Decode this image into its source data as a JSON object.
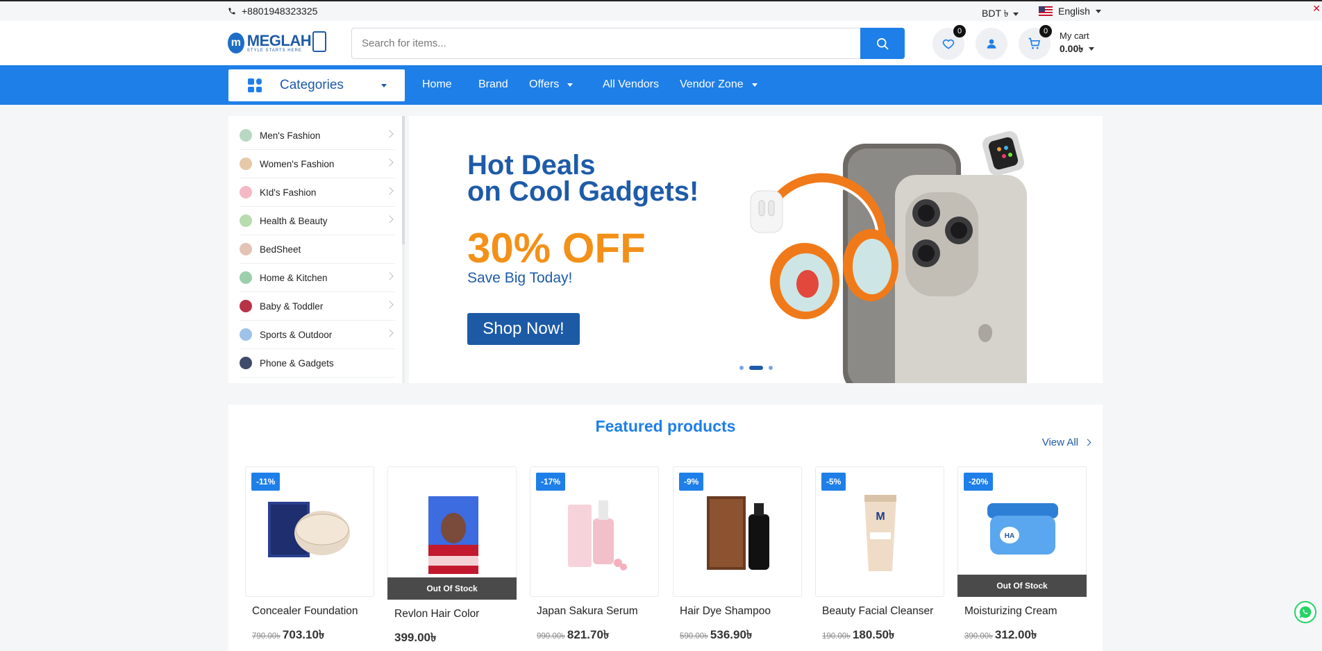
{
  "topbar": {
    "phone": "+8801948323325",
    "currency": "BDT ৳",
    "language": "English"
  },
  "header": {
    "logo_name": "MEGLAH",
    "logo_tagline": "STYLE STARTS HERE",
    "search_placeholder": "Search for items...",
    "wishlist_count": "0",
    "cart_count": "0",
    "cart_label": "My cart",
    "cart_amount": "0.00৳"
  },
  "nav": {
    "categories_label": "Categories",
    "items": [
      "Home",
      "Brand",
      "Offers",
      "All Vendors",
      "Vendor Zone"
    ]
  },
  "categories": [
    {
      "label": "Men's Fashion",
      "color": "#b9d8c4"
    },
    {
      "label": "Women's Fashion",
      "color": "#e7c8a8"
    },
    {
      "label": "KId's Fashion",
      "color": "#f4b9c5"
    },
    {
      "label": "Health & Beauty",
      "color": "#b7dcb0"
    },
    {
      "label": "BedSheet",
      "color": "#e4c3b5"
    },
    {
      "label": "Home & Kitchen",
      "color": "#9ccfab"
    },
    {
      "label": "Baby & Toddler",
      "color": "#b83246"
    },
    {
      "label": "Sports & Outdoor",
      "color": "#9fc3e8"
    },
    {
      "label": "Phone & Gadgets",
      "color": "#3f4b6b"
    }
  ],
  "hero": {
    "title_line1": "Hot Deals",
    "title_line2": "on Cool Gadgets!",
    "offer": "30% OFF",
    "subtitle": "Save Big Today!",
    "cta": "Shop Now!",
    "active_slide": 2,
    "total_slides": 3
  },
  "featured": {
    "title": "Featured products",
    "view_all": "View All",
    "products": [
      {
        "name": "Concealer Foundation",
        "discount": "-11%",
        "old_price": "790.00৳",
        "price": "703.10৳",
        "out_of_stock": ""
      },
      {
        "name": "Revlon Hair Color",
        "discount": "",
        "old_price": "",
        "price": "399.00৳",
        "out_of_stock": "Out Of Stock"
      },
      {
        "name": "Japan Sakura Serum",
        "discount": "-17%",
        "old_price": "990.00৳",
        "price": "821.70৳",
        "out_of_stock": ""
      },
      {
        "name": "Hair Dye Shampoo",
        "discount": "-9%",
        "old_price": "590.00৳",
        "price": "536.90৳",
        "out_of_stock": ""
      },
      {
        "name": "Beauty Facial Cleanser",
        "discount": "-5%",
        "old_price": "190.00৳",
        "price": "180.50৳",
        "out_of_stock": ""
      },
      {
        "name": "Moisturizing Cream",
        "discount": "-20%",
        "old_price": "390.00৳",
        "price": "312.00৳",
        "out_of_stock": "Out Of Stock"
      }
    ]
  },
  "colors": {
    "primary": "#1e7fe8",
    "brand_dark": "#1e5ba8",
    "accent_orange": "#f39018"
  }
}
